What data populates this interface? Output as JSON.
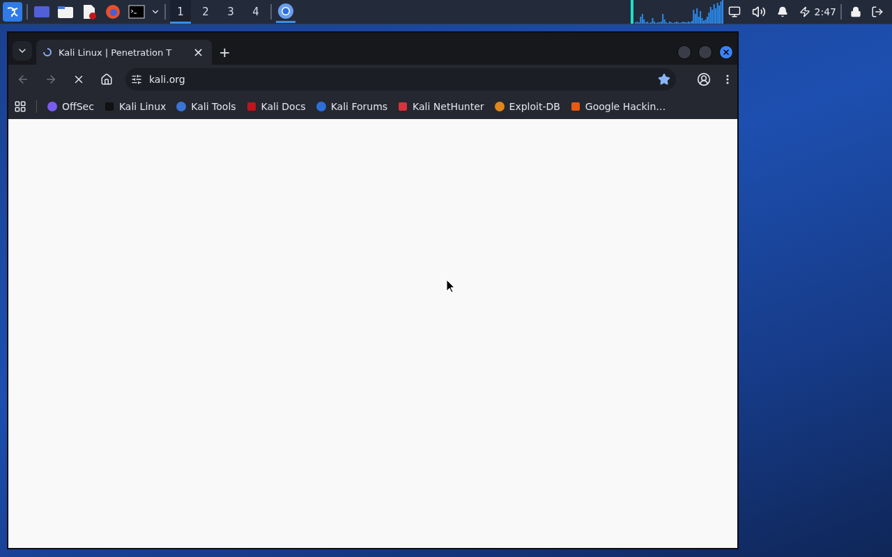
{
  "taskbar": {
    "workspaces": [
      {
        "label": "1",
        "selected": true
      },
      {
        "label": "2",
        "selected": false
      },
      {
        "label": "3",
        "selected": false
      },
      {
        "label": "4",
        "selected": false
      }
    ],
    "clock": "2:47"
  },
  "browser": {
    "tab": {
      "title": "Kali Linux | Penetration T",
      "loading": true,
      "close": "×"
    },
    "new_tab": "+",
    "can_go_back": false,
    "can_go_forward": false,
    "address": "kali.org",
    "starred": true,
    "bookmarks": [
      {
        "label": "OffSec"
      },
      {
        "label": "Kali Linux"
      },
      {
        "label": "Kali Tools"
      },
      {
        "label": "Kali Docs"
      },
      {
        "label": "Kali Forums"
      },
      {
        "label": "Kali NetHunter"
      },
      {
        "label": "Exploit-DB"
      },
      {
        "label": "Google Hackin…"
      }
    ]
  }
}
